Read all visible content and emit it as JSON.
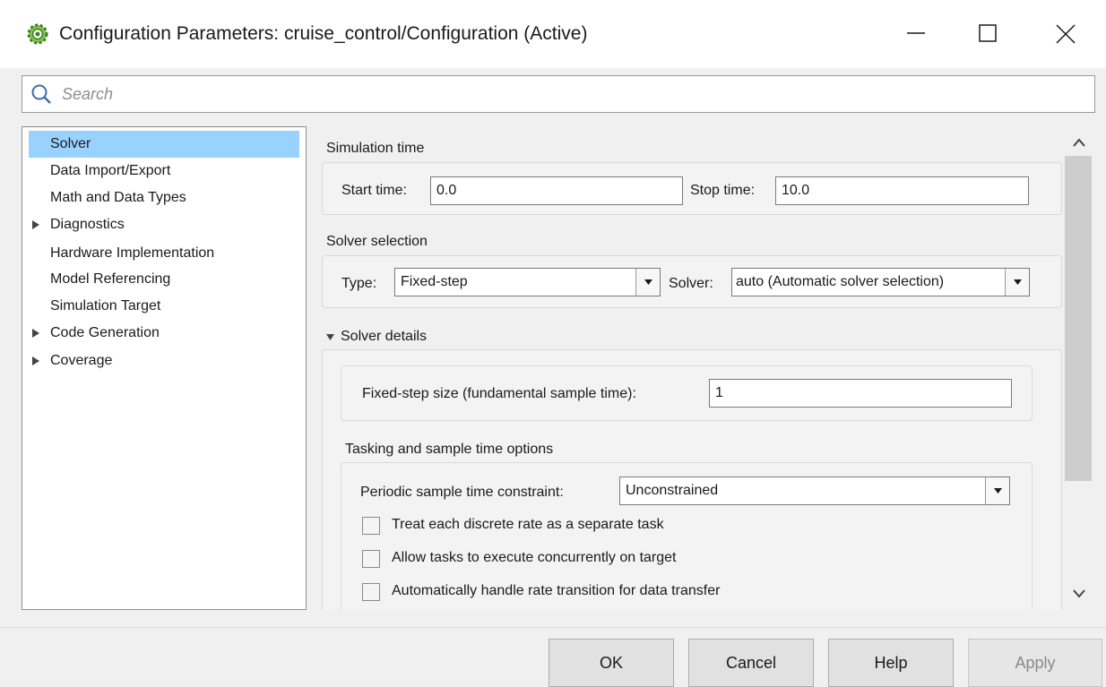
{
  "window": {
    "title": "Configuration Parameters: cruise_control/Configuration (Active)",
    "icon": "gear-icon"
  },
  "search": {
    "placeholder": "Search",
    "value": ""
  },
  "tree": {
    "items": [
      {
        "label": "Solver",
        "selected": true,
        "expandable": false
      },
      {
        "label": "Data Import/Export",
        "selected": false,
        "expandable": false
      },
      {
        "label": "Math and Data Types",
        "selected": false,
        "expandable": false
      },
      {
        "label": "Diagnostics",
        "selected": false,
        "expandable": true
      },
      {
        "label": "Hardware Implementation",
        "selected": false,
        "expandable": false
      },
      {
        "label": "Model Referencing",
        "selected": false,
        "expandable": false
      },
      {
        "label": "Simulation Target",
        "selected": false,
        "expandable": false
      },
      {
        "label": "Code Generation",
        "selected": false,
        "expandable": true
      },
      {
        "label": "Coverage",
        "selected": false,
        "expandable": true
      }
    ]
  },
  "simulation_time": {
    "heading": "Simulation time",
    "start_label": "Start time:",
    "start_value": "0.0",
    "stop_label": "Stop time:",
    "stop_value": "10.0"
  },
  "solver_selection": {
    "heading": "Solver selection",
    "type_label": "Type:",
    "type_value": "Fixed-step",
    "solver_label": "Solver:",
    "solver_value": "auto (Automatic solver selection)"
  },
  "solver_details": {
    "heading": "Solver details",
    "expanded": true,
    "fixed_step_label": "Fixed-step size (fundamental sample time):",
    "fixed_step_value": "1"
  },
  "tasking": {
    "heading": "Tasking and sample time options",
    "periodic_label": "Periodic sample time constraint:",
    "periodic_value": "Unconstrained",
    "checkboxes": [
      {
        "label": "Treat each discrete rate as a separate task",
        "checked": false
      },
      {
        "label": "Allow tasks to execute concurrently on target",
        "checked": false
      },
      {
        "label": "Automatically handle rate transition for data transfer",
        "checked": false
      }
    ]
  },
  "buttons": {
    "ok": "OK",
    "cancel": "Cancel",
    "help": "Help",
    "apply": "Apply"
  },
  "colors": {
    "selection": "#99d1ff",
    "icon_green": "#4caf50"
  }
}
